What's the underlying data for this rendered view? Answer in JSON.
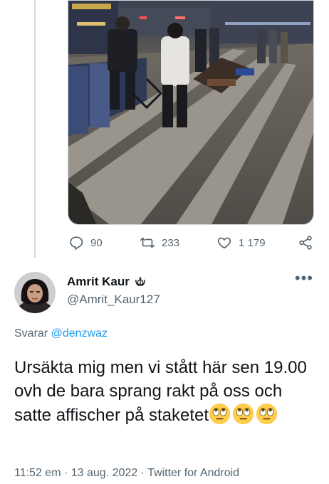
{
  "actions": {
    "replies": "90",
    "retweets": "233",
    "likes": "1 179",
    "icons": [
      "reply-icon",
      "retweet-icon",
      "like-icon",
      "share-icon"
    ]
  },
  "author": {
    "display_name": "Amrit Kaur",
    "badge_icon": "khanda-icon",
    "handle": "@Amrit_Kaur127"
  },
  "reply": {
    "prefix": "Svarar",
    "to_handle": "@denzwaz"
  },
  "tweet": {
    "text": "Ursäkta mig men vi stått här sen 19.00 ovh de bara sprang rakt på oss och satte affischer på staketet",
    "emoji": [
      "face-with-rolling-eyes",
      "face-with-rolling-eyes",
      "face-with-rolling-eyes"
    ]
  },
  "meta": {
    "time": "11:52 em",
    "separator": "·",
    "date": "13 aug. 2022",
    "source": "Twitter for Android"
  },
  "colors": {
    "link": "#1d9bf0",
    "secondary": "#536471",
    "primary_text": "#0f1419",
    "thread_line": "#cfd9de"
  }
}
